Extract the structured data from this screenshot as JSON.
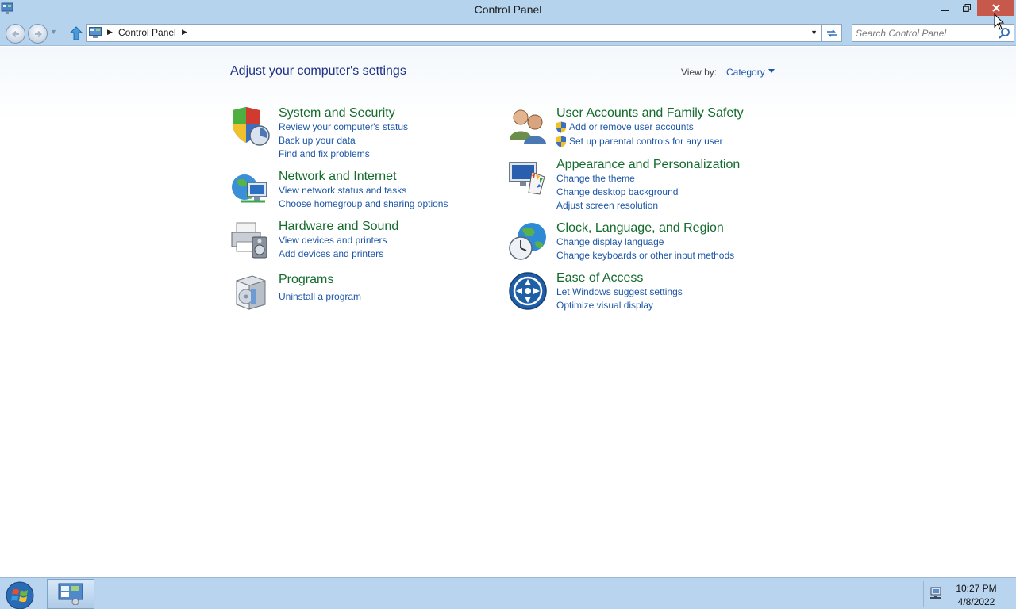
{
  "window": {
    "title": "Control Panel",
    "app_icon": "control-panel-icon",
    "controls": {
      "minimize": "minimize-icon",
      "maximize": "restore-icon",
      "close": "close-icon",
      "close_color": "#c7584c"
    }
  },
  "addressbar": {
    "back_icon": "back-arrow-icon",
    "forward_icon": "forward-arrow-icon",
    "up_icon": "up-arrow-icon",
    "breadcrumb": [
      "Control Panel"
    ],
    "search_placeholder": "Search Control Panel"
  },
  "main": {
    "heading": "Adjust your computer's settings",
    "view_by_label": "View by:",
    "view_by_value": "Category",
    "link_color": "#1d56a8",
    "category_color": "#136b2c",
    "categories_left": [
      {
        "title": "System and Security",
        "icon": "shield-icon",
        "links": [
          "Review your computer's status",
          "Back up your data",
          "Find and fix problems"
        ]
      },
      {
        "title": "Network and Internet",
        "icon": "network-globe-icon",
        "links": [
          "View network status and tasks",
          "Choose homegroup and sharing options"
        ]
      },
      {
        "title": "Hardware and Sound",
        "icon": "printer-speaker-icon",
        "links": [
          "View devices and printers",
          "Add devices and printers"
        ]
      },
      {
        "title": "Programs",
        "icon": "programs-box-icon",
        "links": [
          "Uninstall a program"
        ]
      }
    ],
    "categories_right": [
      {
        "title": "User Accounts and Family Safety",
        "icon": "users-icon",
        "links": [
          "Add or remove user accounts",
          "Set up parental controls for any user"
        ]
      },
      {
        "title": "Appearance and Personalization",
        "icon": "monitor-palette-icon",
        "links": [
          "Change the theme",
          "Change desktop background",
          "Adjust screen resolution"
        ]
      },
      {
        "title": "Clock, Language, and Region",
        "icon": "clock-globe-icon",
        "links": [
          "Change display language",
          "Change keyboards or other input methods"
        ]
      },
      {
        "title": "Ease of Access",
        "icon": "ease-of-access-icon",
        "links": [
          "Let Windows suggest settings",
          "Optimize visual display"
        ]
      }
    ]
  },
  "taskbar": {
    "start_icon": "windows-start-icon",
    "pinned_icon": "control-panel-icon",
    "tray_icon": "network-icon",
    "time": "10:27 PM",
    "date": "4/8/2022"
  }
}
